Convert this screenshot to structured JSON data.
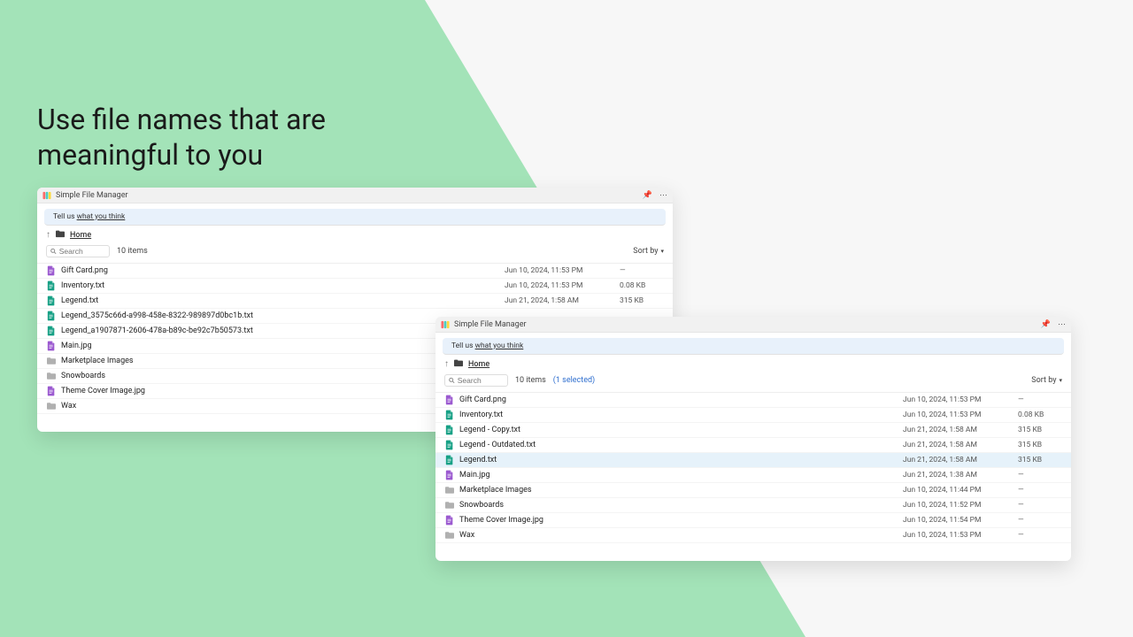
{
  "headline": "Use file names that are meaningful to you",
  "app_title": "Simple File Manager",
  "infobar_prefix": "Tell us ",
  "infobar_link": "what you think",
  "breadcrumb": "Home",
  "search_placeholder": "Search",
  "sort_by": "Sort by",
  "window1": {
    "count_label": "10 items",
    "rows": [
      {
        "icon": "img",
        "name": "Gift Card.png",
        "date": "Jun 10, 2024, 11:53 PM",
        "size": "—"
      },
      {
        "icon": "txt",
        "name": "Inventory.txt",
        "date": "Jun 10, 2024, 11:53 PM",
        "size": "0.08 KB"
      },
      {
        "icon": "txt",
        "name": "Legend.txt",
        "date": "Jun 21, 2024, 1:58 AM",
        "size": "315 KB"
      },
      {
        "icon": "txt",
        "name": "Legend_3575c66d-a998-458e-8322-989897d0bc1b.txt",
        "date": "",
        "size": ""
      },
      {
        "icon": "txt",
        "name": "Legend_a1907871-2606-478a-b89c-be92c7b50573.txt",
        "date": "",
        "size": ""
      },
      {
        "icon": "img",
        "name": "Main.jpg",
        "date": "",
        "size": ""
      },
      {
        "icon": "folder",
        "name": "Marketplace Images",
        "date": "",
        "size": ""
      },
      {
        "icon": "folder",
        "name": "Snowboards",
        "date": "",
        "size": ""
      },
      {
        "icon": "img",
        "name": "Theme Cover Image.jpg",
        "date": "",
        "size": ""
      },
      {
        "icon": "folder",
        "name": "Wax",
        "date": "",
        "size": ""
      }
    ]
  },
  "window2": {
    "count_label": "10 items",
    "selected_label": "(1 selected)",
    "rows": [
      {
        "icon": "img",
        "name": "Gift Card.png",
        "date": "Jun 10, 2024, 11:53 PM",
        "size": "—",
        "selected": false
      },
      {
        "icon": "txt",
        "name": "Inventory.txt",
        "date": "Jun 10, 2024, 11:53 PM",
        "size": "0.08 KB",
        "selected": false
      },
      {
        "icon": "txt",
        "name": "Legend - Copy.txt",
        "date": "Jun 21, 2024, 1:58 AM",
        "size": "315 KB",
        "selected": false
      },
      {
        "icon": "txt",
        "name": "Legend - Outdated.txt",
        "date": "Jun 21, 2024, 1:58 AM",
        "size": "315 KB",
        "selected": false
      },
      {
        "icon": "txt",
        "name": "Legend.txt",
        "date": "Jun 21, 2024, 1:58 AM",
        "size": "315 KB",
        "selected": true
      },
      {
        "icon": "img",
        "name": "Main.jpg",
        "date": "Jun 21, 2024, 1:38 AM",
        "size": "—",
        "selected": false
      },
      {
        "icon": "folder",
        "name": "Marketplace Images",
        "date": "Jun 10, 2024, 11:44 PM",
        "size": "—",
        "selected": false
      },
      {
        "icon": "folder",
        "name": "Snowboards",
        "date": "Jun 10, 2024, 11:52 PM",
        "size": "—",
        "selected": false
      },
      {
        "icon": "img",
        "name": "Theme Cover Image.jpg",
        "date": "Jun 10, 2024, 11:54 PM",
        "size": "—",
        "selected": false
      },
      {
        "icon": "folder",
        "name": "Wax",
        "date": "Jun 10, 2024, 11:53 PM",
        "size": "—",
        "selected": false
      }
    ]
  }
}
